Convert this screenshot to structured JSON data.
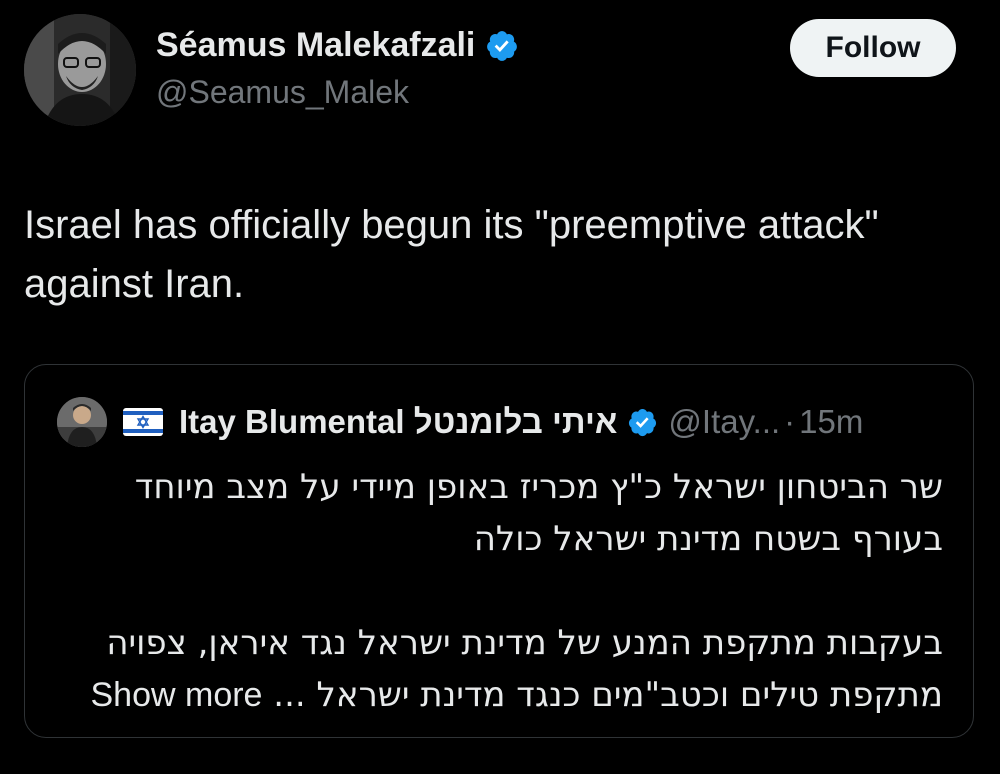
{
  "author": {
    "display_name": "Séamus Malekafzali",
    "handle": "@Seamus_Malek",
    "verified": true,
    "follow_label": "Follow"
  },
  "tweet": {
    "text": "Israel has officially begun its \"preemptive attack\" against Iran."
  },
  "quoted_tweet": {
    "flag_icon": "israel-flag-emoji",
    "display_name": "Itay Blumental איתי בלומנטל",
    "verified": true,
    "handle": "@Itay...",
    "separator": "·",
    "time": "15m",
    "paragraph_1": "שר הביטחון ישראל כ\"ץ מכריז באופן מיידי על מצב מיוחד בעורף בשטח מדינת ישראל כולה",
    "paragraph_2": "בעקבות מתקפת המנע של מדינת ישראל נגד איראן, צפויה מתקפת טילים וכטב\"מים כנגד מדינת ישראל ...",
    "show_more_label": "Show more"
  },
  "colors": {
    "background": "#000000",
    "text_primary": "#e7e9ea",
    "text_secondary": "#71767b",
    "verified_blue": "#1d9bf0",
    "border": "#2f3336",
    "follow_bg": "#eff3f4"
  }
}
